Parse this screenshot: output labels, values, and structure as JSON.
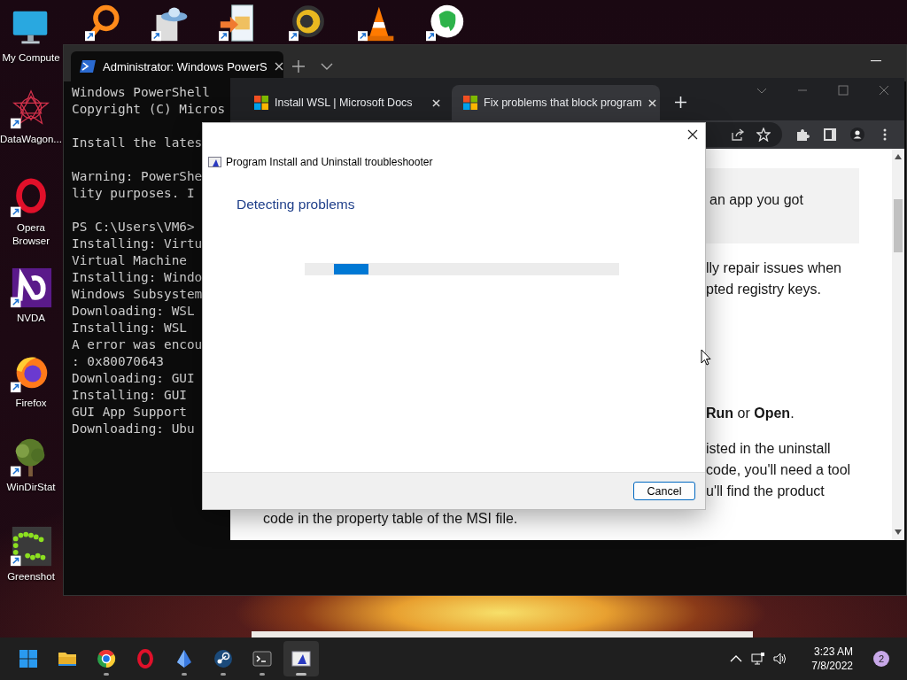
{
  "desktop_icons": [
    {
      "label": "My Compute",
      "kind": "monitor"
    },
    {
      "label": "DataWagon...",
      "kind": "star"
    },
    {
      "label": "Opera Browser",
      "kind": "ring"
    },
    {
      "label": "NVDA",
      "kind": "letter"
    },
    {
      "label": "Firefox",
      "kind": "fox"
    },
    {
      "label": "WinDirStat",
      "kind": "tree"
    },
    {
      "label": "Greenshot",
      "kind": "dots"
    }
  ],
  "terminal": {
    "tabs": [
      {
        "title": "Administrator: Windows PowerS",
        "selected": true
      }
    ],
    "blocks": [
      [
        "Windows PowerShell",
        "Copyright (C) Micros"
      ],
      [
        "Install the lates"
      ],
      [
        "Warning: PowerShe",
        "lity purposes. I"
      ],
      [
        "PS C:\\Users\\VM6>",
        "Installing: Virtu",
        "Virtual Machine",
        "Installing: Windo",
        "Windows Subsystem",
        "Downloading: WSL",
        "Installing: WSL",
        "A error was encou",
        ": 0x80070643",
        "Downloading: GUI",
        "Installing: GUI",
        "GUI App Support",
        "Downloading: Ubu"
      ]
    ]
  },
  "browser": {
    "tabs": [
      {
        "title": "Install WSL | Microsoft Docs",
        "selected": false
      },
      {
        "title": "Fix problems that block program",
        "selected": true
      }
    ],
    "callout": "an app you got",
    "paragraphs": [
      [
        "lly repair issues when",
        "pted registry keys."
      ],
      [
        "**Run** or **Open**."
      ],
      [
        "isted in the uninstall",
        "code, you'll need a tool",
        "u'll find the product"
      ]
    ],
    "last_line": "code in the property table of the MSI file."
  },
  "dialog": {
    "title": "Program Install and Uninstall troubleshooter",
    "heading": "Detecting problems",
    "progress": {
      "indeterminate": true
    },
    "buttons": [
      "Cancel"
    ]
  },
  "taskbar": {
    "apps": [
      {
        "kind": "folder",
        "running": false,
        "selected": false
      },
      {
        "kind": "wheel",
        "running": true,
        "selected": false
      },
      {
        "kind": "ring",
        "running": false,
        "selected": false
      },
      {
        "kind": "crystal",
        "running": true,
        "selected": false
      },
      {
        "kind": "disc",
        "running": true,
        "selected": false
      },
      {
        "kind": "console",
        "running": true,
        "selected": false
      },
      {
        "kind": "window",
        "running": true,
        "selected": true
      }
    ],
    "time": "3:23 AM",
    "date": "7/8/2022",
    "notifications": "2"
  }
}
